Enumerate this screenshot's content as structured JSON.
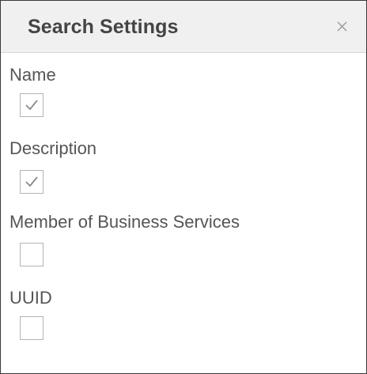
{
  "panel": {
    "title": "Search Settings",
    "close_icon": "close-icon"
  },
  "fields": [
    {
      "label": "Name",
      "checked": true
    },
    {
      "label": "Description",
      "checked": true
    },
    {
      "label": "Member of Business Services",
      "checked": false
    },
    {
      "label": "UUID",
      "checked": false
    }
  ],
  "colors": {
    "header_bg": "#f0f0f0",
    "title_text": "#444444",
    "label_text": "#555555",
    "checkbox_border": "#b3b3b3",
    "checkmark": "#8a8a8a"
  }
}
